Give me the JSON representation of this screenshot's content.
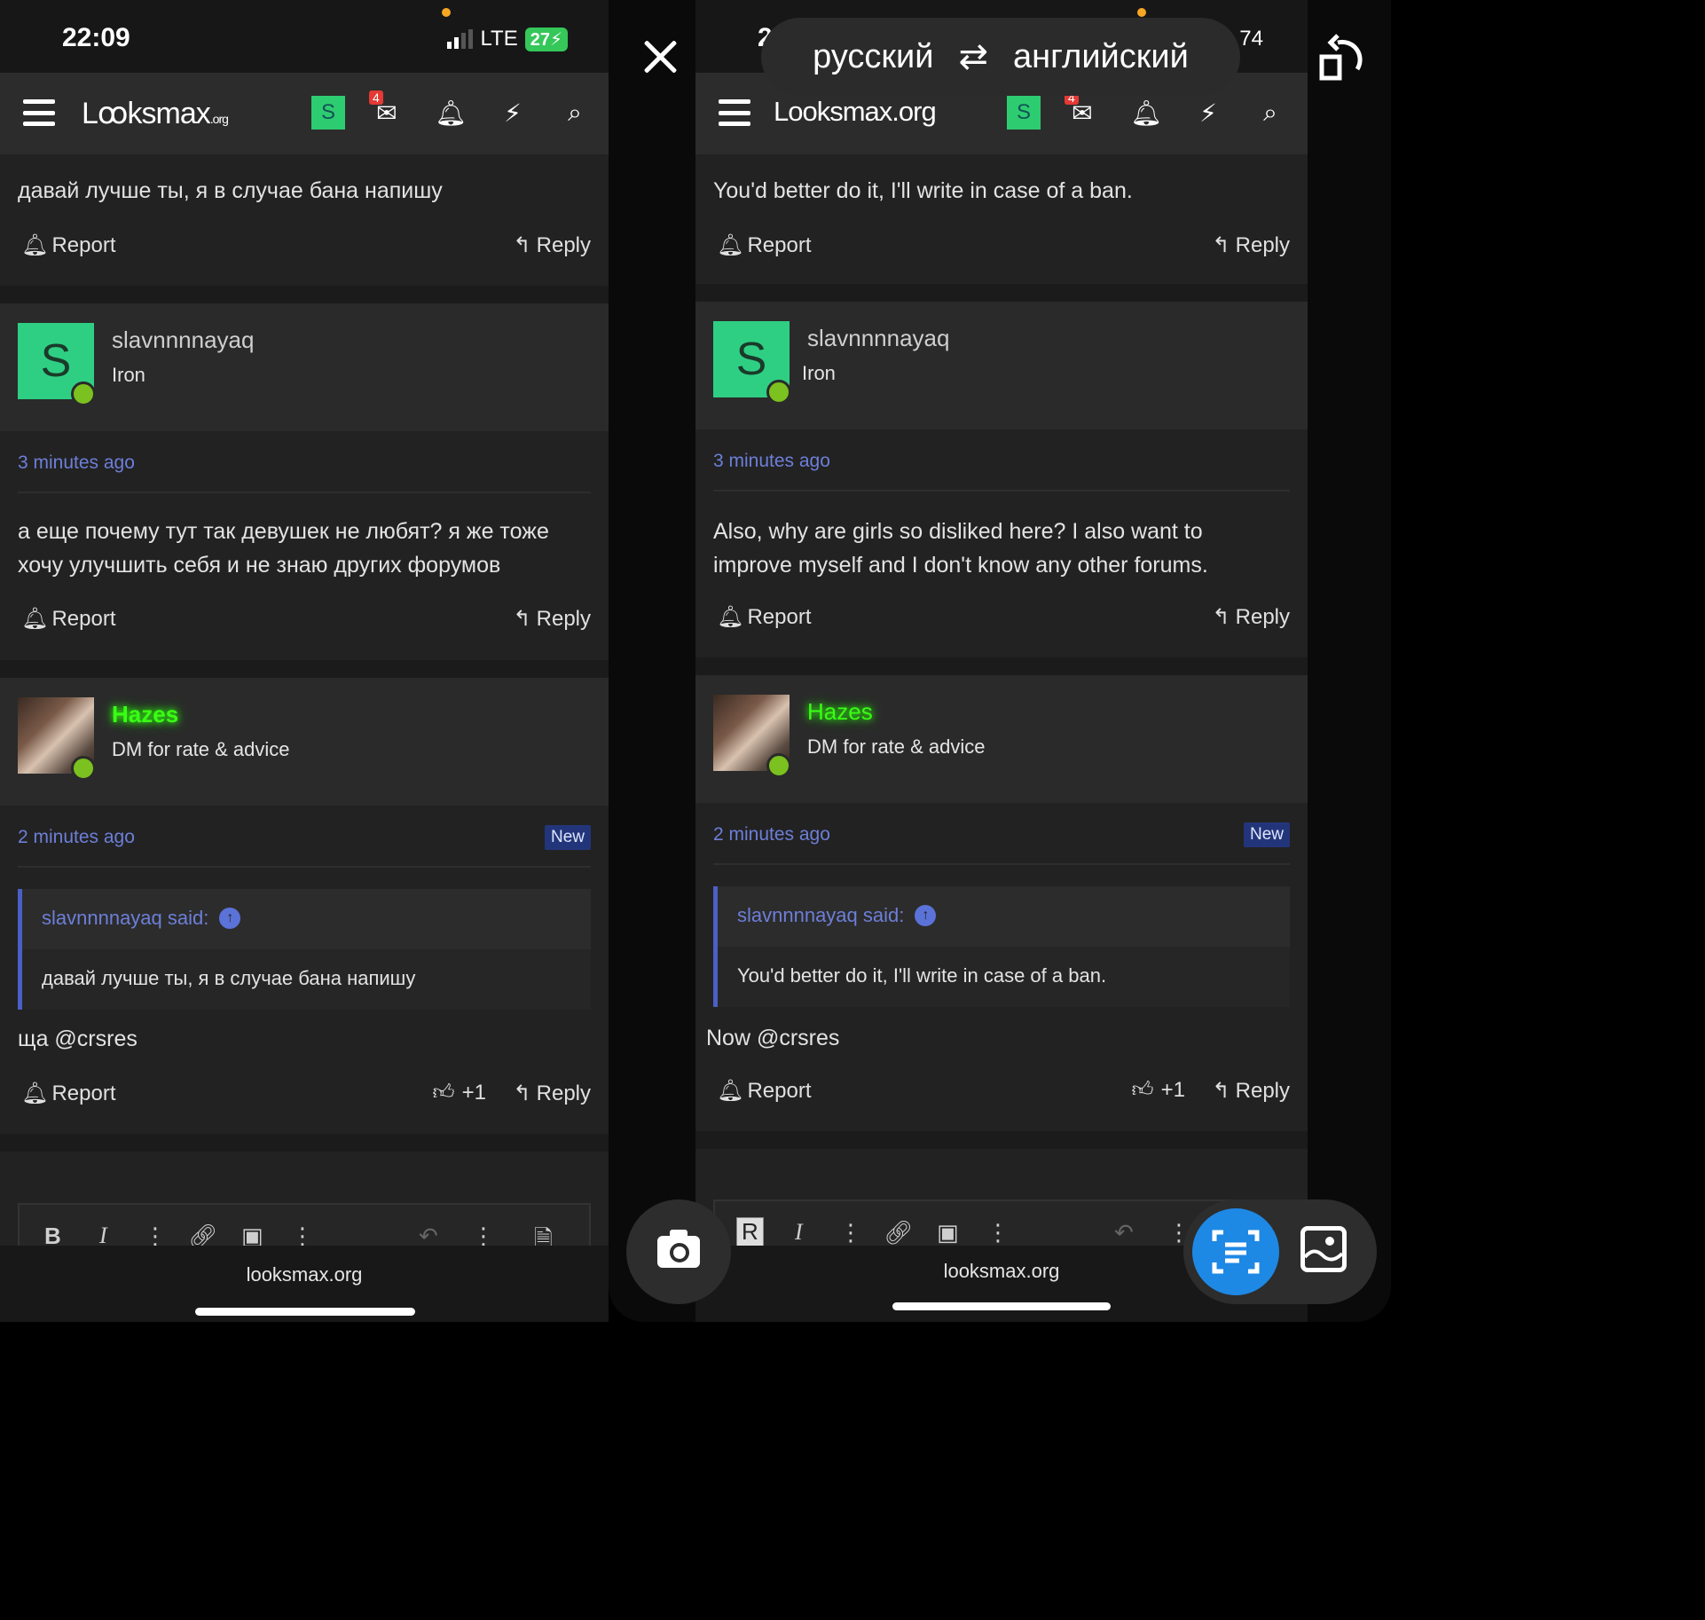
{
  "left": {
    "status": {
      "time": "22:09",
      "network": "LTE",
      "battery": "27"
    },
    "nav": {
      "logo_main": "Lꝏksmax",
      "logo_suffix": ".org",
      "avatar_letter": "S",
      "inbox_count": "4"
    },
    "post1": {
      "text": "давай лучше ты, я в случае бана напишу",
      "report": "Report",
      "reply": "Reply"
    },
    "post2": {
      "author": "slavnnnnayaq",
      "avatar_letter": "S",
      "title": "Iron",
      "time": "3 minutes ago",
      "text_line1": "а еще почему тут так девушек не любят? я же тоже",
      "text_line2": "хочу улучшить себя и не знаю других форумов",
      "report": "Report",
      "reply": "Reply"
    },
    "post3": {
      "author": "Hazes",
      "title": "DM for rate & advice",
      "time": "2 minutes ago",
      "badge": "New",
      "quote_author": "slavnnnnayaq said:",
      "quote_text": "давай лучше ты, я в случае бана напишу",
      "text": "ща @crsres",
      "report": "Report",
      "likes": "+1",
      "reply": "Reply"
    },
    "url": "looksmax.org"
  },
  "right": {
    "status": {
      "time_fragment": "2",
      "battery_fragment": "74"
    },
    "nav": {
      "logo": "Looksmax.org",
      "avatar_letter": "S",
      "inbox_count": "4"
    },
    "post1": {
      "text": "You'd better do it, I'll write in case of a ban.",
      "report": "Report",
      "reply": "Reply"
    },
    "post2": {
      "author": "slavnnnnayaq",
      "avatar_letter": "S",
      "title": "Iron",
      "time": "3 minutes ago",
      "text_line1": "Also, why are girls so disliked here? I also want to",
      "text_line2": "improve myself and I don't know any other forums.",
      "report": "Report",
      "reply": "Reply"
    },
    "post3": {
      "author": "Hazes",
      "title": "DM for rate & advice",
      "time": "2 minutes ago",
      "badge": "New",
      "quote_author": "slavnnnnayaq said:",
      "quote_text": "You'd better do it, I'll write in case of a ban.",
      "text": "Now @crsres",
      "report": "Report",
      "likes": "+1",
      "reply": "Reply"
    },
    "url": "looksmax.org"
  },
  "overlay": {
    "source_lang": "русский",
    "target_lang": "английский",
    "icons": {
      "close": "close-icon",
      "swap": "swap-languages-icon",
      "rotate": "rotate-icon",
      "camera": "camera-icon",
      "text_mode": "text-scan-icon",
      "image_mode": "image-icon"
    },
    "accent_color": "#1e88e5"
  },
  "editor_tools": {
    "bold": "B",
    "italic": "I",
    "right_bold": "R"
  },
  "colors": {
    "online": "#7bc11f",
    "link": "#6d7fd8",
    "hazes_name": "#39ff14",
    "avatar_green": "#2fcf83"
  }
}
